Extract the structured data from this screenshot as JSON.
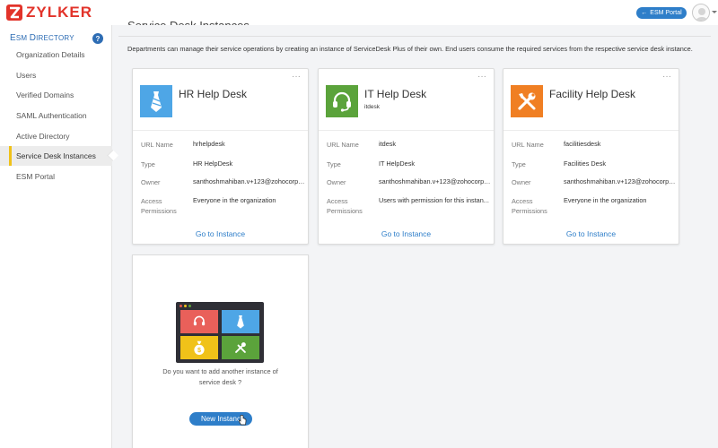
{
  "brand": {
    "name": "ZYLKER"
  },
  "topbar": {
    "portal_label": "ESM Portal"
  },
  "sidebar": {
    "title_first": "E",
    "title_rest_a": "SM ",
    "title_d": "D",
    "title_rest_b": "IRECTORY",
    "help": "?",
    "items": [
      {
        "label": "Organization Details"
      },
      {
        "label": "Users"
      },
      {
        "label": "Verified Domains"
      },
      {
        "label": "SAML Authentication"
      },
      {
        "label": "Active Directory"
      },
      {
        "label": "Service Desk Instances",
        "active": true
      },
      {
        "label": "ESM Portal"
      }
    ]
  },
  "main": {
    "title": "Service Desk Instances",
    "description": "Departments can manage their service operations by creating an instance of ServiceDesk Plus of their own. End users consume the required services from the respective service desk instance.",
    "field_labels": {
      "url": "URL Name",
      "type": "Type",
      "owner": "Owner",
      "access_a": "Access",
      "access_b": "Permissions"
    },
    "menu_glyph": "···",
    "link_label": "Go to Instance",
    "cards": [
      {
        "name": "HR Help Desk",
        "subtitle": "",
        "url": "hrhelpdesk",
        "type": "HR HelpDesk",
        "owner": "santhoshmahiban.v+123@zohocorp....",
        "access": "Everyone in the organization",
        "icon": "tie-icon",
        "color": "#4ea6e6"
      },
      {
        "name": "IT Help Desk",
        "subtitle": "itdesk",
        "url": "itdesk",
        "type": "IT HelpDesk",
        "owner": "santhoshmahiban.v+123@zohocorp....",
        "access": "Users with permission for this instan...",
        "icon": "headset-icon",
        "color": "#5ba33b"
      },
      {
        "name": "Facility Help Desk",
        "subtitle": "",
        "url": "facilitiesdesk",
        "type": "Facilities Desk",
        "owner": "santhoshmahiban.v+123@zohocorp....",
        "access": "Everyone in the organization",
        "icon": "tools-icon",
        "color": "#f07f23"
      }
    ],
    "add": {
      "question_line1": "Do you want to add another instance of",
      "question_line2": "service desk ?",
      "button": "New Instanc"
    }
  }
}
